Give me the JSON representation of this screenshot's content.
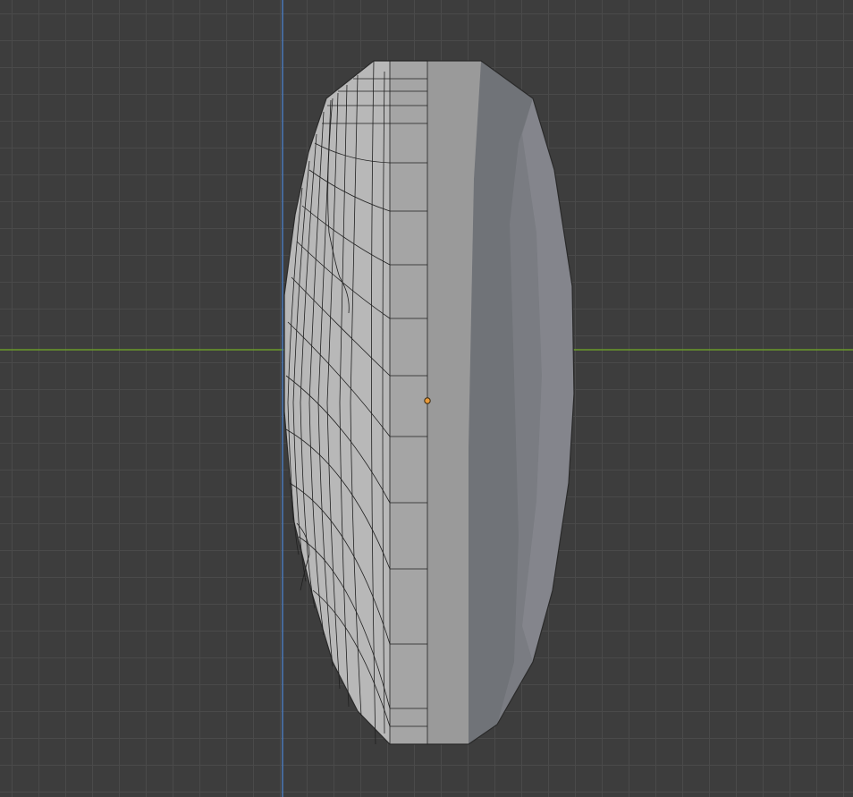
{
  "viewport": {
    "background_color": "#3d3d3d",
    "grid_color": "#4a4a4a",
    "x_axis_color": "#6a9a2a",
    "z_axis_color": "#4a78b8"
  },
  "mesh": {
    "side_face_color": "#b8b8b8",
    "rim_color": "#9a9a9a",
    "back_face_color": "#7a7c82",
    "wire_color": "#202020",
    "origin_color": "#e89a3a"
  }
}
